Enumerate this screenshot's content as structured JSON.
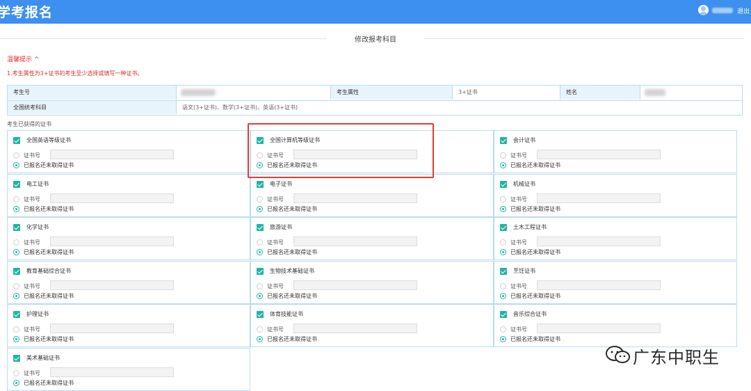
{
  "header": {
    "title": "学考报名",
    "logout_label": "退出"
  },
  "section": {
    "title": "修改报考科目"
  },
  "tips": {
    "toggle_label": "温馨提示 ^",
    "text": "1.考生属性为3+证书的考生至少选择或填写一种证书。"
  },
  "info": {
    "exam_no_label": "考生号",
    "attr_label": "考生属性",
    "attr_value": "3+证书",
    "name_label": "姓名",
    "subjects_label": "全国统考科目",
    "subjects_value": "语文(3+证书)、数学(3+证书)、英语(3+证书)"
  },
  "certs_heading": "考生已获得的证书",
  "radio_labels": {
    "cert_no": "证书号",
    "registered": "已报名还未取得证书"
  },
  "certificates": [
    {
      "name": "全国英语等级证书",
      "checked": true
    },
    {
      "name": "全国计算机等级证书",
      "checked": true
    },
    {
      "name": "会计证书",
      "checked": true
    },
    {
      "name": "电工证书",
      "checked": true
    },
    {
      "name": "电子证书",
      "checked": true
    },
    {
      "name": "机械证书",
      "checked": true
    },
    {
      "name": "化学证书",
      "checked": true
    },
    {
      "name": "旅游证书",
      "checked": true
    },
    {
      "name": "土木工程证书",
      "checked": true
    },
    {
      "name": "教育基础综合证书",
      "checked": true
    },
    {
      "name": "生物技术基础证书",
      "checked": true
    },
    {
      "name": "烹饪证书",
      "checked": true
    },
    {
      "name": "护理证书",
      "checked": true
    },
    {
      "name": "体育技能证书",
      "checked": true
    },
    {
      "name": "音乐综合证书",
      "checked": true
    },
    {
      "name": "美术基础证书",
      "checked": true
    }
  ],
  "watermark": {
    "text": "广东中职生"
  },
  "colors": {
    "header_bg": "#3d8ff0",
    "tip_red": "#e52a2a",
    "checkbox_teal": "#20b4a4",
    "table_border": "#b8dcf0",
    "highlight_red": "#e53935"
  }
}
